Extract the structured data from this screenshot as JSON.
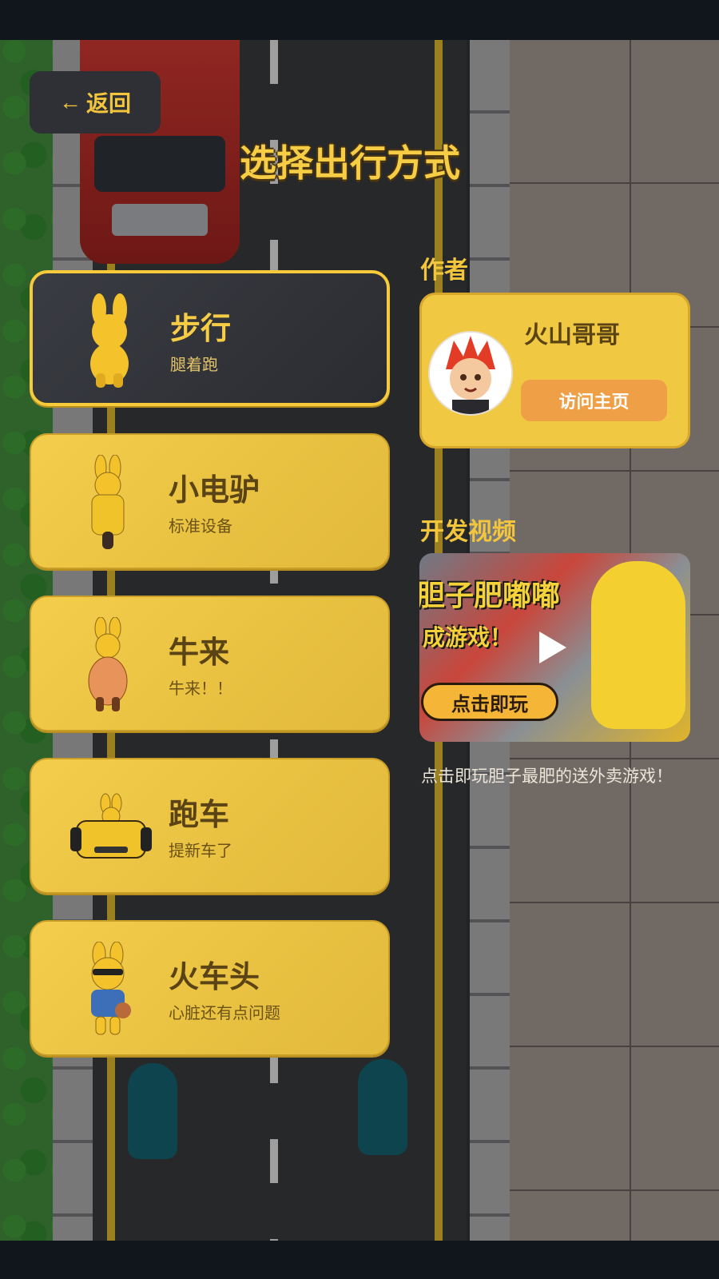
{
  "header": {
    "back_label": "返回",
    "title": "选择出行方式"
  },
  "modes": [
    {
      "name": "步行",
      "desc": "腿着跑",
      "selected": true
    },
    {
      "name": "小电驴",
      "desc": "标准设备",
      "selected": false
    },
    {
      "name": "牛来",
      "desc": "牛来！！",
      "selected": false
    },
    {
      "name": "跑车",
      "desc": "提新车了",
      "selected": false
    },
    {
      "name": "火车头",
      "desc": "心脏还有点问题",
      "selected": false
    }
  ],
  "author": {
    "section_label": "作者",
    "name": "火山哥哥",
    "visit_label": "访问主页"
  },
  "video": {
    "section_label": "开发视频",
    "thumb_title_line1": "胆子肥嘟嘟",
    "thumb_title_line2": "成游戏！",
    "thumb_button": "点击即玩",
    "caption": "点击即玩胆子最肥的送外卖游戏！"
  },
  "colors": {
    "accent": "#f2c53c",
    "card": "#eec446",
    "selected_card": "#2f3137",
    "visit_button": "#ef9f45"
  }
}
